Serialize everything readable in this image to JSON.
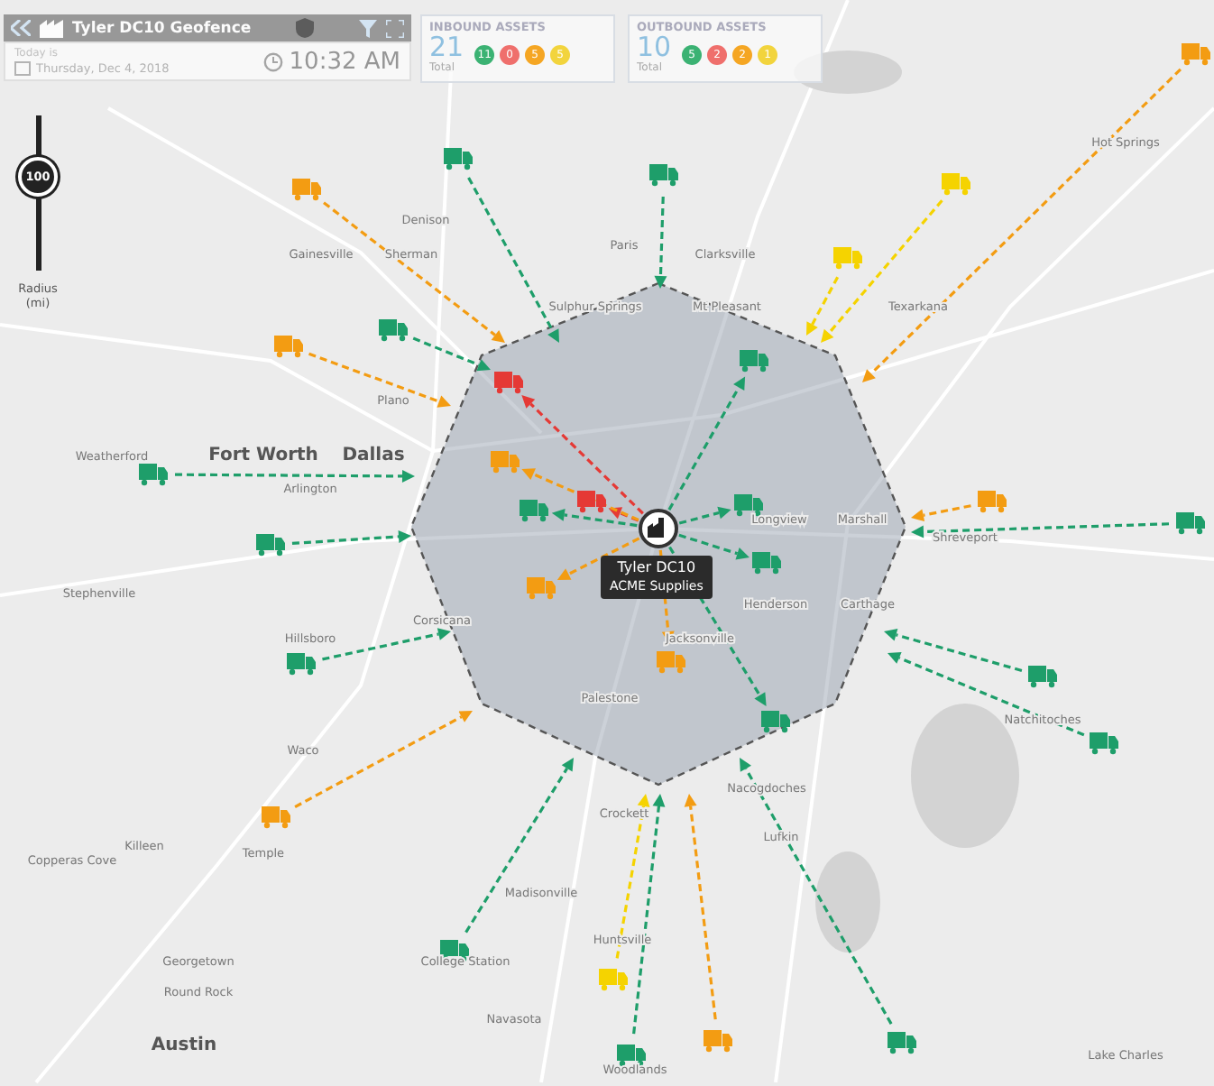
{
  "geofence_panel": {
    "title": "Tyler DC10 Geofence",
    "today_label": "Today is",
    "date": "Thursday, Dec 4, 2018",
    "time": "10:32 AM"
  },
  "inbound": {
    "title": "INBOUND ASSETS",
    "total": "21",
    "total_label": "Total",
    "badges": [
      {
        "count": "11",
        "color": "#3bb273"
      },
      {
        "count": "0",
        "color": "#ef6f6c"
      },
      {
        "count": "5",
        "color": "#f5a623"
      },
      {
        "count": "5",
        "color": "#f2d43d"
      }
    ]
  },
  "outbound": {
    "title": "OUTBOUND ASSETS",
    "total": "10",
    "total_label": "Total",
    "badges": [
      {
        "count": "5",
        "color": "#3bb273"
      },
      {
        "count": "2",
        "color": "#ef6f6c"
      },
      {
        "count": "2",
        "color": "#f5a623"
      },
      {
        "count": "1",
        "color": "#f2d43d"
      }
    ]
  },
  "radius_slider": {
    "value": "100",
    "label": "Radius",
    "unit": "(mi)",
    "level": 0.6
  },
  "facility": {
    "name": "Tyler DC10",
    "company": "ACME Supplies"
  },
  "assets": [
    {
      "kind": "inbound",
      "color": "#1e9e6a"
    },
    {
      "kind": "inbound",
      "color": "#1e9e6a"
    },
    {
      "kind": "inbound",
      "color": "#f39c12"
    },
    {
      "kind": "inbound",
      "color": "#f39c12"
    },
    {
      "kind": "inbound",
      "color": "#1e9e6a"
    },
    {
      "kind": "inbound",
      "color": "#1e9e6a"
    },
    {
      "kind": "inbound",
      "color": "#1e9e6a"
    },
    {
      "kind": "inbound",
      "color": "#1e9e6a"
    },
    {
      "kind": "inbound",
      "color": "#f39c12"
    },
    {
      "kind": "inbound",
      "color": "#1e9e6a"
    },
    {
      "kind": "inbound",
      "color": "#f5d300"
    },
    {
      "kind": "inbound",
      "color": "#1e9e6a"
    },
    {
      "kind": "inbound",
      "color": "#f39c12"
    },
    {
      "kind": "inbound",
      "color": "#1e9e6a"
    },
    {
      "kind": "inbound",
      "color": "#1e9e6a"
    },
    {
      "kind": "inbound",
      "color": "#1e9e6a"
    },
    {
      "kind": "inbound",
      "color": "#f39c12"
    },
    {
      "kind": "inbound",
      "color": "#f39c12"
    },
    {
      "kind": "inbound",
      "color": "#f5d300"
    },
    {
      "kind": "inbound",
      "color": "#f5d300"
    },
    {
      "kind": "inbound",
      "color": "#1e9e6a"
    },
    {
      "kind": "outbound",
      "color": "#e53935"
    },
    {
      "kind": "outbound",
      "color": "#e53935"
    },
    {
      "kind": "outbound",
      "color": "#f39c12"
    },
    {
      "kind": "outbound",
      "color": "#1e9e6a"
    },
    {
      "kind": "outbound",
      "color": "#f39c12"
    },
    {
      "kind": "outbound",
      "color": "#f39c12"
    },
    {
      "kind": "outbound",
      "color": "#1e9e6a"
    },
    {
      "kind": "outbound",
      "color": "#1e9e6a"
    },
    {
      "kind": "outbound",
      "color": "#1e9e6a"
    },
    {
      "kind": "outbound",
      "color": "#1e9e6a"
    }
  ],
  "map_labels": [
    "Hot Springs",
    "Denison",
    "Paris",
    "Gainesville",
    "Sherman",
    "Clarksville",
    "Sulphur Springs",
    "Mt Pleasant",
    "Texarkana",
    "Plano",
    "Weatherford",
    "Fort Worth",
    "Dallas",
    "Arlington",
    "Longview",
    "Marshall",
    "Shreveport",
    "Stephenville",
    "Henderson",
    "Carthage",
    "Corsicana",
    "Hillsboro",
    "Jacksonville",
    "Palestone",
    "Natchitoches",
    "Waco",
    "Nacogdoches",
    "Crockett",
    "Lufkin",
    "Killeen",
    "Temple",
    "Copperas Cove",
    "Madisonville",
    "Huntsville",
    "Georgetown",
    "College Station",
    "Round Rock",
    "Navasota",
    "Austin",
    "Lake Charles",
    "Woodlands"
  ]
}
